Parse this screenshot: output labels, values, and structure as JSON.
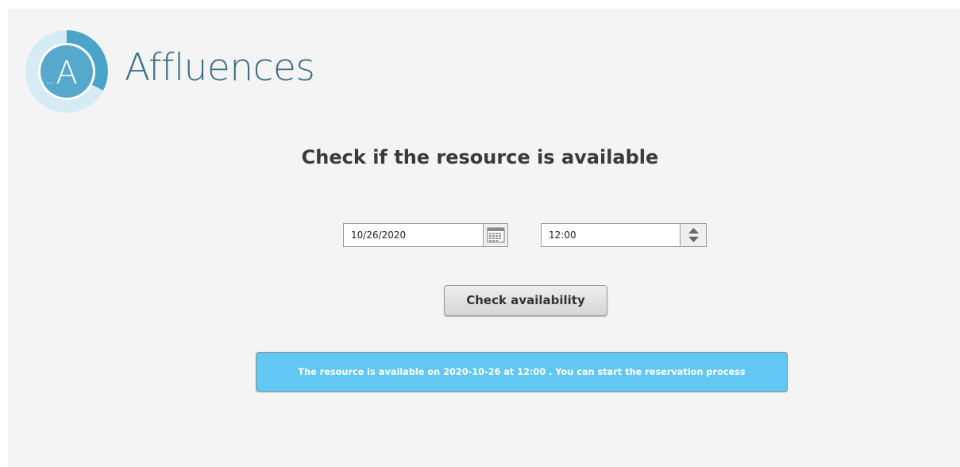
{
  "header": {
    "brand_name": "Affluences",
    "logo_letter": "A",
    "logo_dots": "...",
    "brand_color": "#3b6f86",
    "logo_ring_color": "#4aa3c9"
  },
  "form": {
    "title": "Check if the resource is available",
    "date_value": "10/26/2020",
    "date_icon": "calendar-icon",
    "time_value": "12:00",
    "time_icon": "spinner-arrows-icon",
    "submit_label": "Check availability"
  },
  "result": {
    "message": "The resource is available on 2020-10-26 at 12:00 . You can start the reservation process",
    "background_color": "#62c8f3"
  }
}
